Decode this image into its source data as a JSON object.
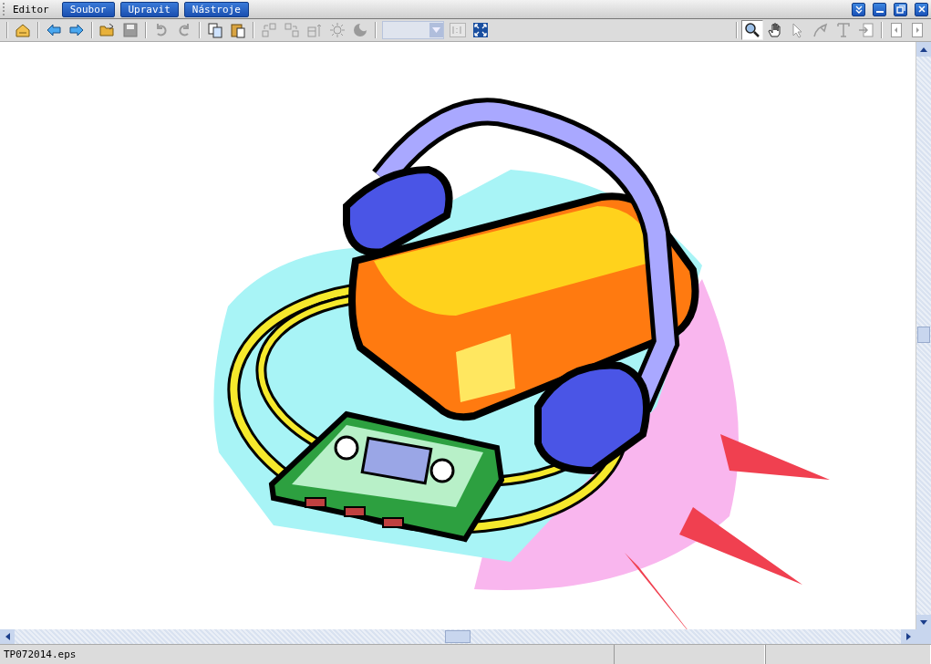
{
  "title_bar": {
    "label": "Editor",
    "menus": [
      {
        "label": "Soubor"
      },
      {
        "label": "Upravit"
      },
      {
        "label": "Nástroje"
      }
    ]
  },
  "toolbar": {
    "left": [
      {
        "disabled": false
      },
      {
        "disabled": false
      },
      {
        "disabled": false
      },
      {
        "disabled": false
      },
      {
        "disabled": true
      },
      {
        "disabled": true
      },
      {
        "disabled": true
      },
      {
        "disabled": false
      },
      {
        "disabled": false
      },
      {
        "disabled": true
      },
      {
        "disabled": true
      },
      {
        "disabled": true
      },
      {
        "disabled": true
      },
      {
        "disabled": true
      },
      {
        "disabled": true
      },
      {
        "disabled": false
      }
    ],
    "tools": [
      {
        "selected": true,
        "disabled": false
      },
      {
        "selected": false,
        "disabled": false
      },
      {
        "selected": false,
        "disabled": true
      },
      {
        "selected": false,
        "disabled": true
      },
      {
        "selected": false,
        "disabled": true
      },
      {
        "selected": false,
        "disabled": true
      }
    ],
    "pages": [
      {
        "disabled": true
      },
      {
        "disabled": true
      }
    ]
  },
  "status_bar": {
    "file_name": "TP072014.eps"
  }
}
